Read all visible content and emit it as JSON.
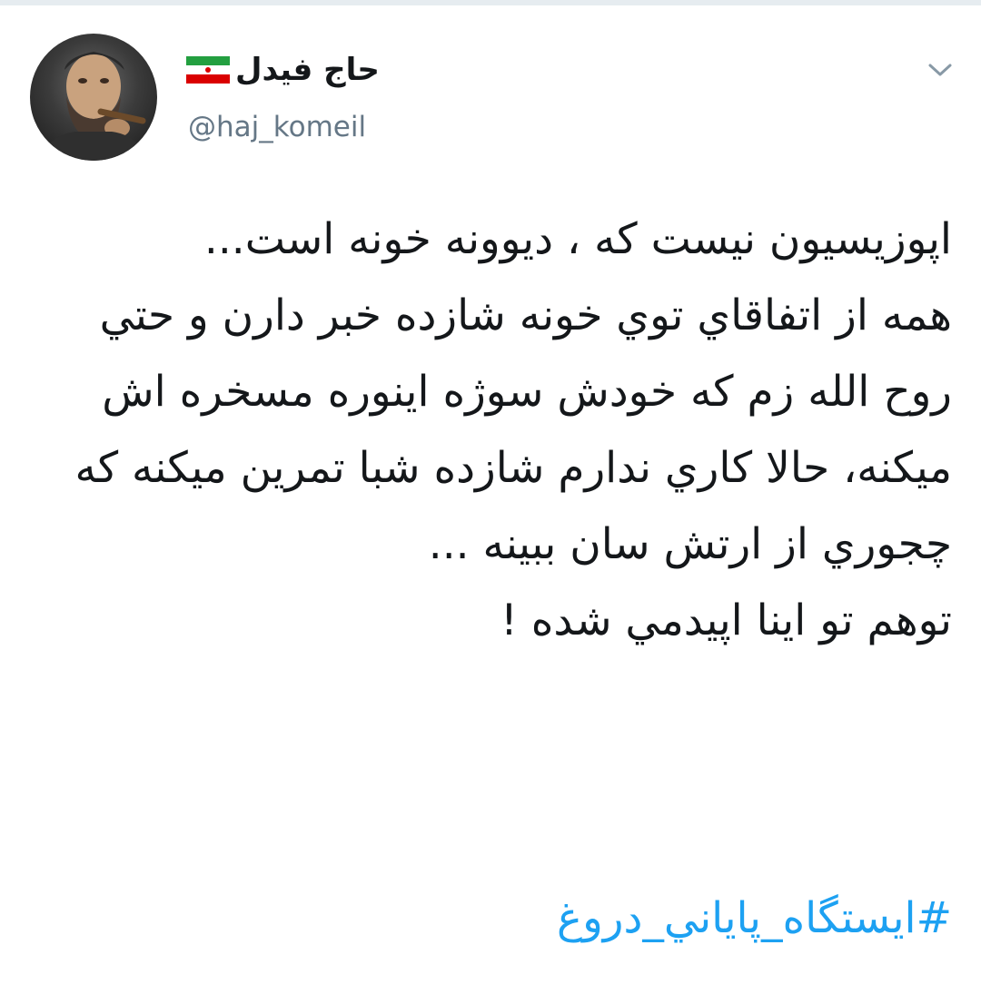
{
  "tweet": {
    "author": {
      "display_name": "حاج فیدل",
      "flag_icon": "iran-flag-icon",
      "handle": "@haj_komeil"
    },
    "menu_icon": "chevron-down-icon",
    "text": "اپوزیسیون نیست که ، دیوونه خونه است...\nهمه از اتفاقاي توي خونه شازده خبر دارن و حتي روح الله زم که خودش سوژه اینوره مسخره اش میکنه، حالا کاري ندارم شازده شبا تمرین میکنه که چجوري از ارتش سان ببینه ...\nتوهم تو اینا اپیدمي شده !",
    "hashtag": "#ایستگاه_پایاني_دروغ"
  },
  "colors": {
    "text": "#14171a",
    "muted": "#657786",
    "link": "#1da1f2",
    "divider": "#e6ecf0"
  }
}
